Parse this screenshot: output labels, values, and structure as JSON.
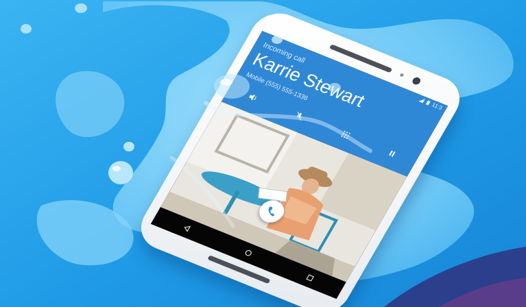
{
  "call": {
    "label": "Incoming call",
    "caller_name": "Karrie Stewart",
    "caller_number": "Mobile (555) 555-1336"
  },
  "status_bar": {
    "time": "11:3"
  },
  "icons": {
    "speaker": "speaker-icon",
    "mute": "mute-mic-icon",
    "dialpad": "dialpad-icon",
    "hold": "pause-icon",
    "answer": "phone-answer-icon",
    "nav_back": "back-triangle-icon",
    "nav_home": "home-circle-icon"
  },
  "colors": {
    "background_blue": "#2aa6ec",
    "water_light": "#7dd2fa",
    "call_header": "#2f88d6",
    "corner_navy": "#2b3f8c",
    "corner_purple": "#5a3d8a"
  }
}
